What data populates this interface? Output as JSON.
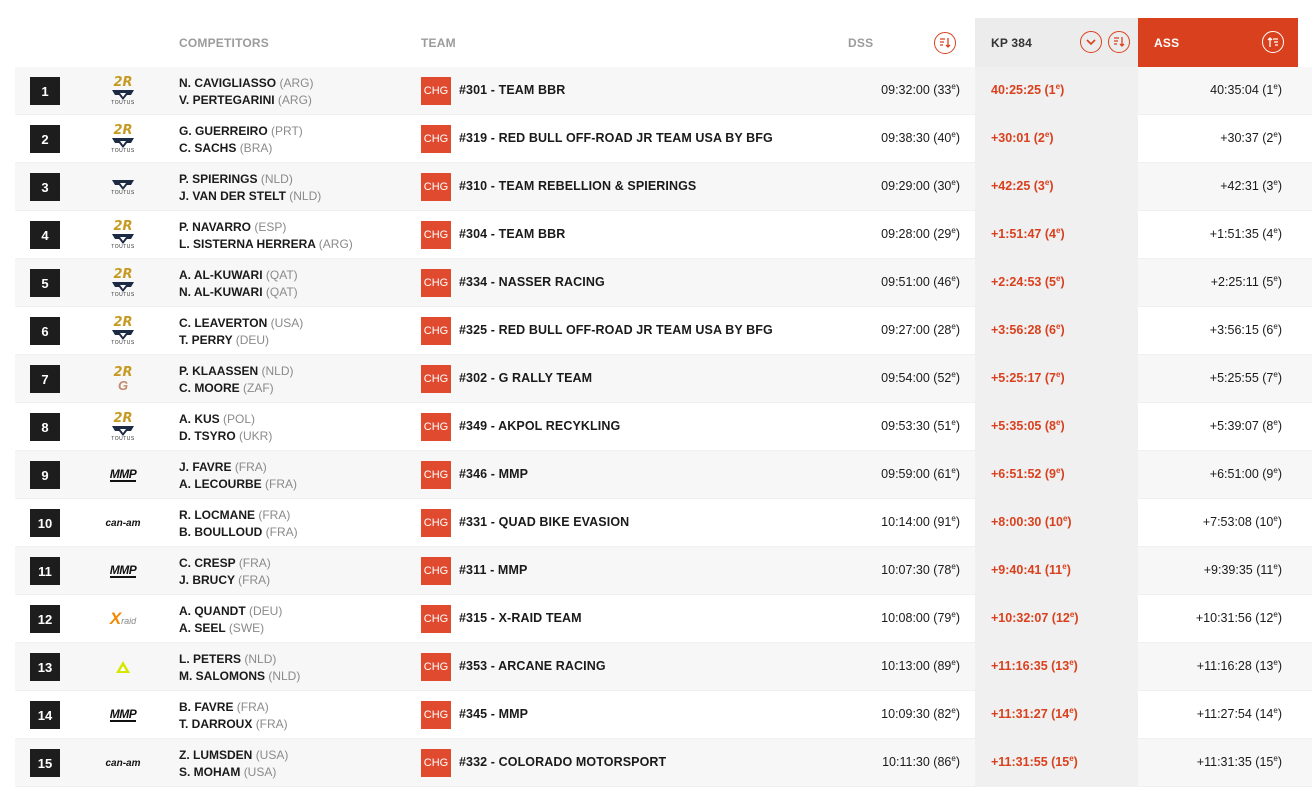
{
  "header": {
    "competitors": "COMPETITORS",
    "team": "TEAM",
    "dss": "DSS",
    "kp": "KP 384",
    "ass": "ASS"
  },
  "icons": {
    "dss_sort": "sort-descending-icon",
    "kp_expand": "chevron-down-icon",
    "kp_sort": "sort-descending-icon",
    "ass_sort": "sort-ascending-icon"
  },
  "colors": {
    "accent": "#d9411e",
    "chg": "#e04a2f",
    "rank_bg": "#1d1d1d"
  },
  "rows": [
    {
      "rank": "1",
      "logo": "2r-toutus",
      "d1": "N. CAVIGLIASSO",
      "n1": "(ARG)",
      "d2": "V. PERTEGARINI",
      "n2": "(ARG)",
      "chg": "CHG",
      "team": "#301 - TEAM BBR",
      "dss": "09:32:00 (33",
      "dss_pos": "e",
      "kp": "40:25:25 (1",
      "kp_pos": "e",
      "ass": "40:35:04 (1",
      "ass_pos": "e"
    },
    {
      "rank": "2",
      "logo": "2r-toutus",
      "d1": "G. GUERREIRO",
      "n1": "(PRT)",
      "d2": "C. SACHS",
      "n2": "(BRA)",
      "chg": "CHG",
      "team": "#319 - RED BULL OFF-ROAD JR TEAM USA BY BFG",
      "dss": "09:38:30 (40",
      "dss_pos": "e",
      "kp": "+30:01 (2",
      "kp_pos": "e",
      "ass": "+30:37 (2",
      "ass_pos": "e"
    },
    {
      "rank": "3",
      "logo": "toutus",
      "d1": "P. SPIERINGS",
      "n1": "(NLD)",
      "d2": "J. VAN DER STELT",
      "n2": "(NLD)",
      "chg": "CHG",
      "team": "#310 - TEAM REBELLION & SPIERINGS",
      "dss": "09:29:00 (30",
      "dss_pos": "e",
      "kp": "+42:25 (3",
      "kp_pos": "e",
      "ass": "+42:31 (3",
      "ass_pos": "e"
    },
    {
      "rank": "4",
      "logo": "2r-toutus",
      "d1": "P. NAVARRO",
      "n1": "(ESP)",
      "d2": "L. SISTERNA HERRERA",
      "n2": "(ARG)",
      "chg": "CHG",
      "team": "#304 - TEAM BBR",
      "dss": "09:28:00 (29",
      "dss_pos": "e",
      "kp": "+1:51:47 (4",
      "kp_pos": "e",
      "ass": "+1:51:35 (4",
      "ass_pos": "e"
    },
    {
      "rank": "5",
      "logo": "2r-toutus",
      "d1": "A. AL-KUWARI",
      "n1": "(QAT)",
      "d2": "N. AL-KUWARI",
      "n2": "(QAT)",
      "chg": "CHG",
      "team": "#334 - NASSER RACING",
      "dss": "09:51:00 (46",
      "dss_pos": "e",
      "kp": "+2:24:53 (5",
      "kp_pos": "e",
      "ass": "+2:25:11 (5",
      "ass_pos": "e"
    },
    {
      "rank": "6",
      "logo": "2r-toutus",
      "d1": "C. LEAVERTON",
      "n1": "(USA)",
      "d2": "T. PERRY",
      "n2": "(DEU)",
      "chg": "CHG",
      "team": "#325 - RED BULL OFF-ROAD JR TEAM USA BY BFG",
      "dss": "09:27:00 (28",
      "dss_pos": "e",
      "kp": "+3:56:28 (6",
      "kp_pos": "e",
      "ass": "+3:56:15 (6",
      "ass_pos": "e"
    },
    {
      "rank": "7",
      "logo": "2r-g",
      "d1": "P. KLAASSEN",
      "n1": "(NLD)",
      "d2": "C. MOORE",
      "n2": "(ZAF)",
      "chg": "CHG",
      "team": "#302 - G RALLY TEAM",
      "dss": "09:54:00 (52",
      "dss_pos": "e",
      "kp": "+5:25:17 (7",
      "kp_pos": "e",
      "ass": "+5:25:55 (7",
      "ass_pos": "e"
    },
    {
      "rank": "8",
      "logo": "2r-toutus",
      "d1": "A. KUS",
      "n1": "(POL)",
      "d2": "D. TSYRO",
      "n2": "(UKR)",
      "chg": "CHG",
      "team": "#349 - AKPOL RECYKLING",
      "dss": "09:53:30 (51",
      "dss_pos": "e",
      "kp": "+5:35:05 (8",
      "kp_pos": "e",
      "ass": "+5:39:07 (8",
      "ass_pos": "e"
    },
    {
      "rank": "9",
      "logo": "mmp",
      "d1": "J. FAVRE",
      "n1": "(FRA)",
      "d2": "A. LECOURBE",
      "n2": "(FRA)",
      "chg": "CHG",
      "team": "#346 - MMP",
      "dss": "09:59:00 (61",
      "dss_pos": "e",
      "kp": "+6:51:52 (9",
      "kp_pos": "e",
      "ass": "+6:51:00 (9",
      "ass_pos": "e"
    },
    {
      "rank": "10",
      "logo": "canam",
      "d1": "R. LOCMANE",
      "n1": "(FRA)",
      "d2": "B. BOULLOUD",
      "n2": "(FRA)",
      "chg": "CHG",
      "team": "#331 - QUAD BIKE EVASION",
      "dss": "10:14:00 (91",
      "dss_pos": "e",
      "kp": "+8:00:30 (10",
      "kp_pos": "e",
      "ass": "+7:53:08 (10",
      "ass_pos": "e"
    },
    {
      "rank": "11",
      "logo": "mmp",
      "d1": "C. CRESP",
      "n1": "(FRA)",
      "d2": "J. BRUCY",
      "n2": "(FRA)",
      "chg": "CHG",
      "team": "#311 - MMP",
      "dss": "10:07:30 (78",
      "dss_pos": "e",
      "kp": "+9:40:41 (11",
      "kp_pos": "e",
      "ass": "+9:39:35 (11",
      "ass_pos": "e"
    },
    {
      "rank": "12",
      "logo": "xraid",
      "d1": "A. QUANDT",
      "n1": "(DEU)",
      "d2": "A. SEEL",
      "n2": "(SWE)",
      "chg": "CHG",
      "team": "#315 - X-RAID TEAM",
      "dss": "10:08:00 (79",
      "dss_pos": "e",
      "kp": "+10:32:07 (12",
      "kp_pos": "e",
      "ass": "+10:31:56 (12",
      "ass_pos": "e"
    },
    {
      "rank": "13",
      "logo": "arcane",
      "d1": "L. PETERS",
      "n1": "(NLD)",
      "d2": "M. SALOMONS",
      "n2": "(NLD)",
      "chg": "CHG",
      "team": "#353 - ARCANE RACING",
      "dss": "10:13:00 (89",
      "dss_pos": "e",
      "kp": "+11:16:35 (13",
      "kp_pos": "e",
      "ass": "+11:16:28 (13",
      "ass_pos": "e"
    },
    {
      "rank": "14",
      "logo": "mmp",
      "d1": "B. FAVRE",
      "n1": "(FRA)",
      "d2": "T. DARROUX",
      "n2": "(FRA)",
      "chg": "CHG",
      "team": "#345 - MMP",
      "dss": "10:09:30 (82",
      "dss_pos": "e",
      "kp": "+11:31:27 (14",
      "kp_pos": "e",
      "ass": "+11:27:54 (14",
      "ass_pos": "e"
    },
    {
      "rank": "15",
      "logo": "canam",
      "d1": "Z. LUMSDEN",
      "n1": "(USA)",
      "d2": "S. MOHAM",
      "n2": "(USA)",
      "chg": "CHG",
      "team": "#332 - COLORADO MOTORSPORT",
      "dss": "10:11:30 (86",
      "dss_pos": "e",
      "kp": "+11:31:55 (15",
      "kp_pos": "e",
      "ass": "+11:31:35 (15",
      "ass_pos": "e"
    }
  ]
}
